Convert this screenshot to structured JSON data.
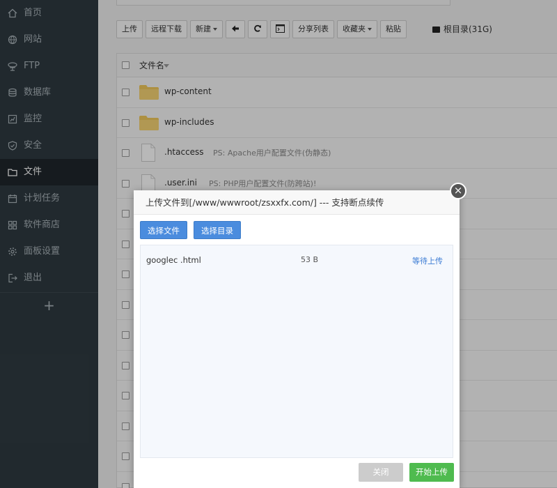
{
  "sidebar": {
    "items": [
      {
        "label": "首页",
        "icon": "home-icon"
      },
      {
        "label": "网站",
        "icon": "globe-icon"
      },
      {
        "label": "FTP",
        "icon": "ftp-icon"
      },
      {
        "label": "数据库",
        "icon": "database-icon"
      },
      {
        "label": "监控",
        "icon": "monitor-icon"
      },
      {
        "label": "安全",
        "icon": "shield-icon"
      },
      {
        "label": "文件",
        "icon": "folder-icon",
        "active": true
      },
      {
        "label": "计划任务",
        "icon": "calendar-icon"
      },
      {
        "label": "软件商店",
        "icon": "grid-icon"
      },
      {
        "label": "面板设置",
        "icon": "gear-icon"
      },
      {
        "label": "退出",
        "icon": "logout-icon"
      }
    ],
    "add_label": "+"
  },
  "toolbar": {
    "upload": "上传",
    "remote_download": "远程下载",
    "new": "新建",
    "share_list": "分享列表",
    "favorites": "收藏夹",
    "paste": "粘贴",
    "disk": "根目录(31G)"
  },
  "file_table": {
    "header": "文件名",
    "rows": [
      {
        "type": "folder",
        "name": "wp-content",
        "ps": ""
      },
      {
        "type": "folder",
        "name": "wp-includes",
        "ps": ""
      },
      {
        "type": "file",
        "name": ".htaccess",
        "ps": "PS: Apache用户配置文件(伪静态)"
      },
      {
        "type": "file",
        "name": ".user.ini",
        "ps": "PS: PHP用户配置文件(防跨站)!"
      }
    ]
  },
  "dialog": {
    "title": "上传文件到[/www/wwwroot/zsxxfx.com/] --- 支持断点续传",
    "close_symbol": "×",
    "select_file": "选择文件",
    "select_dir": "选择目录",
    "file": {
      "name": "googlec                     .html",
      "size": "53 B",
      "status": "等待上传"
    },
    "btn_close": "关闭",
    "btn_start": "开始上传"
  },
  "colors": {
    "sidebar_bg": "#2f3a41",
    "primary_blue": "#4a8cde",
    "start_green": "#4fbb4f"
  }
}
